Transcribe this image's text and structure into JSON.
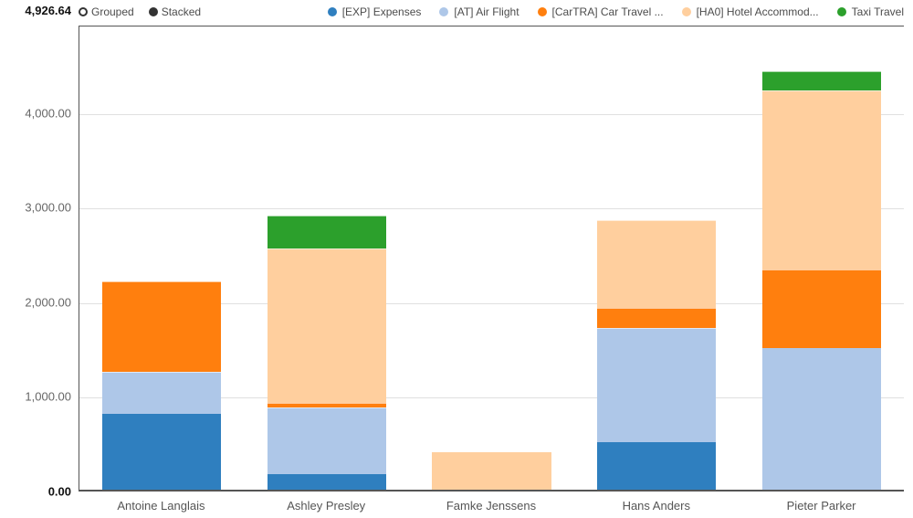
{
  "mode": {
    "grouped_label": "Grouped",
    "stacked_label": "Stacked",
    "selected": "stacked"
  },
  "legend": [
    {
      "name": "[EXP] Expenses",
      "color": "#2f7fbf"
    },
    {
      "name": "[AT] Air Flight",
      "color": "#aec7e8"
    },
    {
      "name": "[CarTRA] Car Travel ...",
      "color": "#ff7f0e"
    },
    {
      "name": "[HA0] Hotel Accommod...",
      "color": "#ffcf9e"
    },
    {
      "name": "Taxi Travel",
      "color": "#2ca02c"
    }
  ],
  "y_axis": {
    "max_label": "4,926.64",
    "ticks": [
      {
        "value": 4000,
        "label": "4,000.00"
      },
      {
        "value": 3000,
        "label": "3,000.00"
      },
      {
        "value": 2000,
        "label": "2,000.00"
      },
      {
        "value": 1000,
        "label": "1,000.00"
      },
      {
        "value": 0,
        "label": "0.00"
      }
    ]
  },
  "chart_data": {
    "type": "bar",
    "stacked": true,
    "ylim": [
      0,
      4926.64
    ],
    "ylabel": "",
    "xlabel": "",
    "categories": [
      "Antoine Langlais",
      "Ashley Presley",
      "Famke Jenssens",
      "Hans Anders",
      "Pieter Parker"
    ],
    "series": [
      {
        "name": "[EXP] Expenses",
        "color": "#2f7fbf",
        "values": [
          800,
          160,
          0,
          500,
          0
        ]
      },
      {
        "name": "[AT] Air Flight",
        "color": "#aec7e8",
        "values": [
          440,
          700,
          0,
          1200,
          1500
        ]
      },
      {
        "name": "[CarTRA] Car Travel ...",
        "color": "#ff7f0e",
        "values": [
          940,
          40,
          0,
          200,
          820
        ]
      },
      {
        "name": "[HA0] Hotel Accommod...",
        "color": "#ffcf9e",
        "values": [
          0,
          1620,
          400,
          920,
          1880
        ]
      },
      {
        "name": "Taxi Travel",
        "color": "#2ca02c",
        "values": [
          0,
          340,
          0,
          0,
          200
        ]
      }
    ]
  }
}
